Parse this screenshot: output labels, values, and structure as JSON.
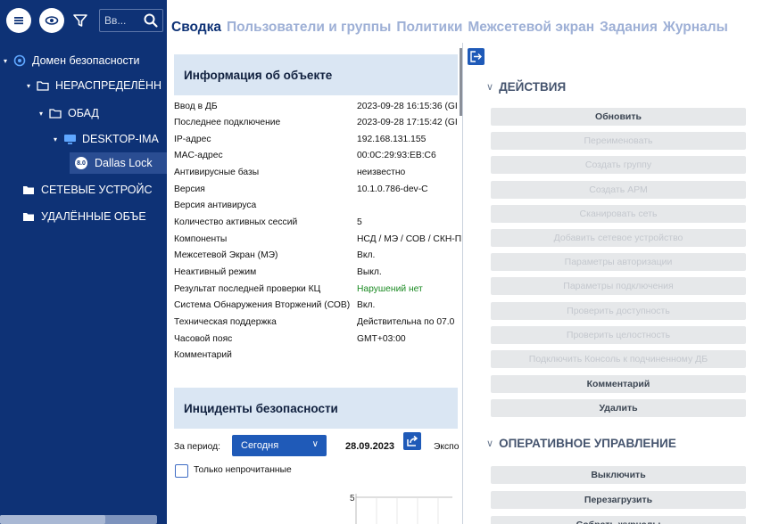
{
  "toolbar": {
    "search_placeholder": "Вв..."
  },
  "tree": {
    "items": [
      {
        "label": "Домен безопасности",
        "arrow": "▾"
      },
      {
        "label": "НЕРАСПРЕДЕЛЁНН",
        "arrow": "▾"
      },
      {
        "label": "ОБАД",
        "arrow": "▾"
      },
      {
        "label": "DESKTOP-IMA",
        "arrow": "▾"
      },
      {
        "label": "Dallas Lock",
        "badge": "8.0"
      },
      {
        "label": "СЕТЕВЫЕ УСТРОЙС"
      },
      {
        "label": "УДАЛЁННЫЕ ОБЪЕ"
      }
    ]
  },
  "tabs": [
    {
      "label": "Сводка",
      "active": true
    },
    {
      "label": "Пользователи и группы"
    },
    {
      "label": "Политики"
    },
    {
      "label": "Межсетевой экран"
    },
    {
      "label": "Задания"
    },
    {
      "label": "Журналы"
    }
  ],
  "info_panel": {
    "title": "Информация об объекте",
    "rows": [
      {
        "key": "Ввод в ДБ",
        "value": "2023-09-28 16:15:36 (GI"
      },
      {
        "key": "Последнее подключение",
        "value": "2023-09-28 17:15:42 (GI"
      },
      {
        "key": "IP-адрес",
        "value": "192.168.131.155"
      },
      {
        "key": "MAC-адрес",
        "value": "00:0C:29:93:EB:C6"
      },
      {
        "key": "Антивирусные базы",
        "value": "неизвестно"
      },
      {
        "key": "Версия",
        "value": "10.1.0.786-dev-C"
      },
      {
        "key": "Версия антивируса",
        "value": ""
      },
      {
        "key": "Количество активных сессий",
        "value": "5"
      },
      {
        "key": "Компоненты",
        "value": "НСД / МЭ / СОВ / СКН-П"
      },
      {
        "key": "Межсетевой Экран (МЭ)",
        "value": "Вкл."
      },
      {
        "key": "Неактивный режим",
        "value": "Выкл."
      },
      {
        "key": "Результат последней проверки КЦ",
        "value": "Нарушений нет",
        "status": "ok"
      },
      {
        "key": "Система Обнаружения Вторжений (СОВ)",
        "value": "Вкл."
      },
      {
        "key": "Техническая поддержка",
        "value": "Действительна по 07.0"
      },
      {
        "key": "Часовой пояс",
        "value": "GMT+03:00"
      },
      {
        "key": "Комментарий",
        "value": ""
      }
    ]
  },
  "incidents": {
    "title": "Инциденты безопасности",
    "period_label": "За период:",
    "period_value": "Сегодня",
    "date": "28.09.2023",
    "export_label": "Экспо",
    "unread_only_label": "Только непрочитанные",
    "chart_tick": "5"
  },
  "actions": {
    "section_title": "ДЕЙСТВИЯ",
    "buttons": [
      {
        "label": "Обновить",
        "enabled": true
      },
      {
        "label": "Переименовать",
        "enabled": false
      },
      {
        "label": "Создать группу",
        "enabled": false
      },
      {
        "label": "Создать АРМ",
        "enabled": false
      },
      {
        "label": "Сканировать сеть",
        "enabled": false
      },
      {
        "label": "Добавить сетевое устройство",
        "enabled": false
      },
      {
        "label": "Параметры авторизации",
        "enabled": false
      },
      {
        "label": "Параметры подключения",
        "enabled": false
      },
      {
        "label": "Проверить доступность",
        "enabled": false
      },
      {
        "label": "Проверить целостность",
        "enabled": false
      },
      {
        "label": "Подключить Консоль к подчиненному ДБ",
        "enabled": false
      },
      {
        "label": "Комментарий",
        "enabled": true
      },
      {
        "label": "Удалить",
        "enabled": true
      }
    ]
  },
  "operational": {
    "section_title": "ОПЕРАТИВНОЕ УПРАВЛЕНИЕ",
    "buttons": [
      {
        "label": "Выключить",
        "enabled": true
      },
      {
        "label": "Перезагрузить",
        "enabled": true
      },
      {
        "label": "Собрать журналы",
        "enabled": true
      }
    ]
  },
  "colors": {
    "sidebar": "#0e3276",
    "accent": "#1f5ab8",
    "header_bg": "#dae6f3",
    "ok_green": "#1a8a22"
  }
}
